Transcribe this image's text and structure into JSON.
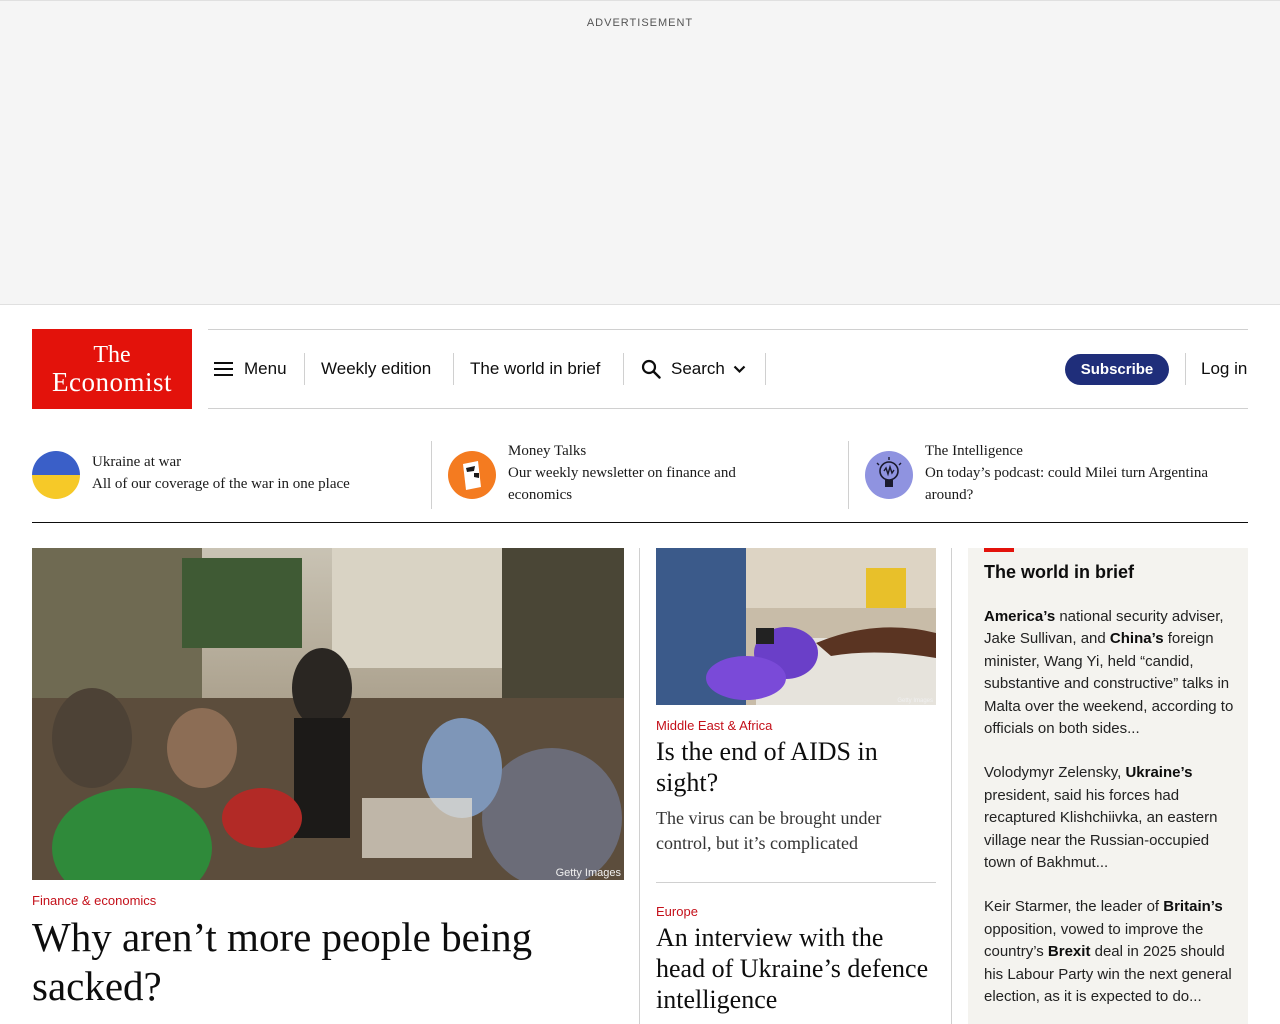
{
  "ad": {
    "label": "ADVERTISEMENT"
  },
  "header": {
    "logo_line1": "The",
    "logo_line2": "Economist",
    "menu_label": "Menu",
    "weekly_edition": "Weekly edition",
    "world_in_brief": "The world in brief",
    "search_label": "Search",
    "subscribe_label": "Subscribe",
    "login_label": "Log in",
    "colors": {
      "brand_red": "#e3120b",
      "subscribe_bg": "#1f2e7a"
    }
  },
  "promos": [
    {
      "title": "Ukraine at war",
      "text": "All of our coverage of the war in one place",
      "icon": "ukraine-flag-icon"
    },
    {
      "title": "Money Talks",
      "text_line1": "Our weekly newsletter on finance and",
      "text_line2": "economics",
      "icon": "money-talks-icon"
    },
    {
      "title": "The Intelligence",
      "text_line1": "On today’s podcast: could Milei turn Argentina",
      "text_line2": "around?",
      "icon": "lightbulb-icon"
    }
  ],
  "lead_story": {
    "image_credit": "Getty Images",
    "section": "Finance & economics",
    "headline_line1": "Why aren’t more people being",
    "headline_line2": "sacked?"
  },
  "second_story": {
    "image_credit": "Getty Images",
    "section": "Middle East & Africa",
    "headline_line1": "Is the end of AIDS in",
    "headline_line2": "sight?",
    "standfirst_line1": "The virus can be brought under",
    "standfirst_line2": "control, but it’s complicated"
  },
  "third_story": {
    "section": "Europe",
    "headline_line1": "An interview with the",
    "headline_line2": "head of Ukraine’s defence",
    "headline_line3": "intelligence"
  },
  "world_in_brief": {
    "title": "The world in brief",
    "items": [
      {
        "pre": "",
        "b1": "America’s",
        "mid": " national security adviser, Jake Sullivan, and ",
        "b2": "China’s",
        "post": " foreign minister, Wang Yi, held “candid, substantive and constructive” talks in Malta over the weekend, according to officials on both sides..."
      },
      {
        "pre": "Volodymyr Zelensky, ",
        "b1": "Ukraine’s",
        "mid": " president, said his forces had recaptured Klishchiivka, an eastern village near the Russian-occupied town of Bakhmut...",
        "b2": "",
        "post": ""
      },
      {
        "pre": "Keir Starmer, the leader of ",
        "b1": "Britain’s",
        "mid": " opposition, vowed to improve the country’s ",
        "b2": "Brexit",
        "post": " deal in 2025 should his Labour Party win the next general election, as it is expected to do..."
      }
    ]
  }
}
